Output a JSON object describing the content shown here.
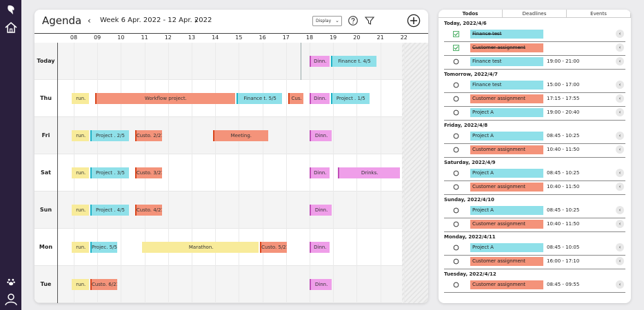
{
  "agenda": {
    "title": "Agenda",
    "prev": "‹",
    "next": "›",
    "week_label": "Week 6 Apr. 2022 - 12 Apr. 2022",
    "display_label": "Display",
    "hours": [
      "08",
      "09",
      "10",
      "11",
      "12",
      "13",
      "14",
      "15",
      "16",
      "17",
      "18",
      "19",
      "20",
      "21",
      "22"
    ],
    "days": [
      "Today",
      "Thu",
      "Fri",
      "Sat",
      "Sun",
      "Mon",
      "Tue"
    ],
    "events": [
      {
        "day": 0,
        "start": 18.0,
        "end": 18.9,
        "color": "pink",
        "label": "Dinn."
      },
      {
        "day": 0,
        "start": 18.9,
        "end": 20.9,
        "color": "cyan",
        "label": "Finance t. 4/5"
      },
      {
        "day": 1,
        "start": 7.9,
        "end": 8.7,
        "color": "yellow",
        "label": "run."
      },
      {
        "day": 1,
        "start": 8.9,
        "end": 14.9,
        "color": "salmon",
        "label": "Workflow project."
      },
      {
        "day": 1,
        "start": 14.9,
        "end": 16.9,
        "color": "cyan",
        "label": "Finance t. 5/5"
      },
      {
        "day": 1,
        "start": 17.1,
        "end": 17.8,
        "color": "salmon",
        "label": "Cus."
      },
      {
        "day": 1,
        "start": 18.0,
        "end": 18.9,
        "color": "pink",
        "label": "Dinn."
      },
      {
        "day": 1,
        "start": 18.9,
        "end": 20.6,
        "color": "cyan",
        "label": "Project . 1/5"
      },
      {
        "day": 2,
        "start": 7.9,
        "end": 8.7,
        "color": "yellow",
        "label": "run."
      },
      {
        "day": 2,
        "start": 8.7,
        "end": 10.4,
        "color": "cyan",
        "label": "Project . 2/5"
      },
      {
        "day": 2,
        "start": 10.6,
        "end": 11.8,
        "color": "salmon",
        "label": "Custo. 2/21"
      },
      {
        "day": 2,
        "start": 13.9,
        "end": 16.3,
        "color": "salmon",
        "label": "Meeting."
      },
      {
        "day": 2,
        "start": 18.0,
        "end": 19.0,
        "color": "pink",
        "label": "Dinn."
      },
      {
        "day": 3,
        "start": 7.9,
        "end": 8.7,
        "color": "yellow",
        "label": "run."
      },
      {
        "day": 3,
        "start": 8.7,
        "end": 10.4,
        "color": "cyan",
        "label": "Project . 3/5"
      },
      {
        "day": 3,
        "start": 10.6,
        "end": 11.8,
        "color": "salmon",
        "label": "Custo. 3/21"
      },
      {
        "day": 3,
        "start": 18.0,
        "end": 18.9,
        "color": "pink",
        "label": "Dinn."
      },
      {
        "day": 3,
        "start": 19.2,
        "end": 21.9,
        "color": "pink",
        "label": "Drinks."
      },
      {
        "day": 4,
        "start": 7.9,
        "end": 8.7,
        "color": "yellow",
        "label": "run."
      },
      {
        "day": 4,
        "start": 8.7,
        "end": 10.4,
        "color": "cyan",
        "label": "Project . 4/5"
      },
      {
        "day": 4,
        "start": 10.6,
        "end": 11.8,
        "color": "salmon",
        "label": "Custo. 4/21"
      },
      {
        "day": 4,
        "start": 18.0,
        "end": 19.0,
        "color": "pink",
        "label": "Dinn."
      },
      {
        "day": 5,
        "start": 7.9,
        "end": 8.7,
        "color": "yellow",
        "label": "run."
      },
      {
        "day": 5,
        "start": 8.7,
        "end": 9.9,
        "color": "cyan",
        "label": "Projec. 5/5"
      },
      {
        "day": 5,
        "start": 10.9,
        "end": 15.9,
        "color": "yellow",
        "label": "Marathon."
      },
      {
        "day": 5,
        "start": 15.9,
        "end": 17.1,
        "color": "salmon",
        "label": "Custo. 5/21"
      },
      {
        "day": 5,
        "start": 18.0,
        "end": 18.9,
        "color": "pink",
        "label": "Dinn."
      },
      {
        "day": 6,
        "start": 7.9,
        "end": 8.7,
        "color": "yellow",
        "label": "run."
      },
      {
        "day": 6,
        "start": 8.7,
        "end": 9.9,
        "color": "salmon",
        "label": "Custo. 6/21"
      },
      {
        "day": 6,
        "start": 18.0,
        "end": 19.0,
        "color": "pink",
        "label": "Dinn."
      }
    ]
  },
  "todos": {
    "tabs": [
      "Todos",
      "Deadlines",
      "Events"
    ],
    "active_tab": 0,
    "sections": [
      {
        "heading": "Today, 2022/4/6",
        "items": [
          {
            "label": "Finance test",
            "color": "cyan",
            "done": true,
            "time": ""
          },
          {
            "label": "Customer assignment",
            "color": "salmon",
            "done": true,
            "time": ""
          },
          {
            "label": "Finance test",
            "color": "cyan",
            "done": false,
            "time": "19:00 - 21:00"
          }
        ]
      },
      {
        "heading": "Tomorrow, 2022/4/7",
        "items": [
          {
            "label": "Finance test",
            "color": "cyan",
            "done": false,
            "time": "15:00 - 17:00"
          },
          {
            "label": "Customer assignment",
            "color": "salmon",
            "done": false,
            "time": "17:15 - 17:55"
          },
          {
            "label": "Project A",
            "color": "cyan",
            "done": false,
            "time": "19:00 - 20:40"
          }
        ]
      },
      {
        "heading": "Friday, 2022/4/8",
        "items": [
          {
            "label": "Project A",
            "color": "cyan",
            "done": false,
            "time": "08:45 - 10:25"
          },
          {
            "label": "Customer assignment",
            "color": "salmon",
            "done": false,
            "time": "10:40 - 11:50"
          }
        ]
      },
      {
        "heading": "Saturday, 2022/4/9",
        "items": [
          {
            "label": "Project A",
            "color": "cyan",
            "done": false,
            "time": "08:45 - 10:25"
          },
          {
            "label": "Customer assignment",
            "color": "salmon",
            "done": false,
            "time": "10:40 - 11:50"
          }
        ]
      },
      {
        "heading": "Sunday, 2022/4/10",
        "items": [
          {
            "label": "Project A",
            "color": "cyan",
            "done": false,
            "time": "08:45 - 10:25"
          },
          {
            "label": "Customer assignment",
            "color": "salmon",
            "done": false,
            "time": "10:40 - 11:50"
          }
        ]
      },
      {
        "heading": "Monday, 2022/4/11",
        "items": [
          {
            "label": "Project A",
            "color": "cyan",
            "done": false,
            "time": "08:45 - 10:05"
          },
          {
            "label": "Customer assignment",
            "color": "salmon",
            "done": false,
            "time": "16:00 - 17:10"
          }
        ]
      },
      {
        "heading": "Tuesday, 2022/4/12",
        "items": [
          {
            "label": "Customer assignment",
            "color": "salmon",
            "done": false,
            "time": "08:45 - 09:55"
          }
        ]
      }
    ]
  },
  "icons": {
    "logo": "logo-icon",
    "home": "home-icon",
    "paw": "paw-icon",
    "user": "user-icon",
    "help": "help-icon",
    "filter": "filter-icon",
    "add": "add-icon"
  },
  "colors": {
    "rail": "#2a1f3d",
    "yellow": "#f8eb9a",
    "cyan": "#8fe0e9",
    "salmon": "#f4937a",
    "pink": "#ef9ee9",
    "check": "#3aa655"
  }
}
